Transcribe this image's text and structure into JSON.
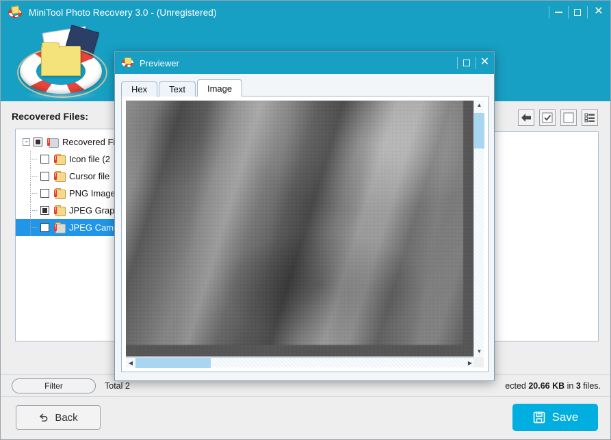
{
  "window": {
    "title": "MiniTool Photo Recovery 3.0 - (Unregistered)",
    "logo_icon": "lifering-photos-icon",
    "controls": {
      "minimize": "minimize-icon",
      "maximize": "maximize-icon",
      "close": "close-icon"
    }
  },
  "main": {
    "recovered_label": "Recovered Files:",
    "tree": {
      "root": {
        "label": "Recovered Fil",
        "expander": "−",
        "checkbox": "partial",
        "icon": "device-warning-icon"
      },
      "items": [
        {
          "label": "Icon file (2",
          "checkbox": "unchecked",
          "icon": "folder-warning-icon"
        },
        {
          "label": "Cursor file",
          "checkbox": "unchecked",
          "icon": "folder-warning-icon"
        },
        {
          "label": "PNG Image",
          "checkbox": "unchecked",
          "icon": "folder-warning-icon"
        },
        {
          "label": "JPEG Grap",
          "checkbox": "partial",
          "icon": "folder-warning-icon"
        },
        {
          "label": "JPEG Came",
          "checkbox": "unchecked",
          "icon": "folder-warning-icon",
          "selected": true
        }
      ]
    },
    "toolbar": [
      {
        "name": "back-arrow-button",
        "icon": "arrow-left-icon"
      },
      {
        "name": "select-all-button",
        "icon": "checkbox-checked-icon"
      },
      {
        "name": "deselect-all-button",
        "icon": "checkbox-empty-icon"
      },
      {
        "name": "list-view-button",
        "icon": "list-view-icon"
      }
    ]
  },
  "status": {
    "filter_label": "Filter",
    "left_text": "Total 2",
    "right_prefix": "ected",
    "right_size": "20.66 KB",
    "right_middle": "in",
    "right_count": "3",
    "right_suffix": "files."
  },
  "footer": {
    "back_label": "Back",
    "back_icon": "undo-arrow-icon",
    "save_label": "Save",
    "save_icon": "floppy-disk-icon",
    "save_color": "#00aee0"
  },
  "dialog": {
    "title": "Previewer",
    "logo_icon": "lifering-icon",
    "maximize": "maximize-icon",
    "close": "close-icon",
    "tabs": [
      {
        "label": "Hex",
        "active": false
      },
      {
        "label": "Text",
        "active": false
      },
      {
        "label": "Image",
        "active": true
      }
    ],
    "preview": {
      "content": "grayscale-fabric-folds-photo",
      "vscroll_icon_up": "▲",
      "vscroll_icon_down": "▼",
      "hscroll_icon_left": "◀",
      "hscroll_icon_right": "▶"
    }
  },
  "theme": {
    "accent_teal": "#17a0c4",
    "accent_blue": "#00aee0",
    "selection_blue": "#2196e8",
    "scroll_thumb": "#a8d6f0"
  }
}
